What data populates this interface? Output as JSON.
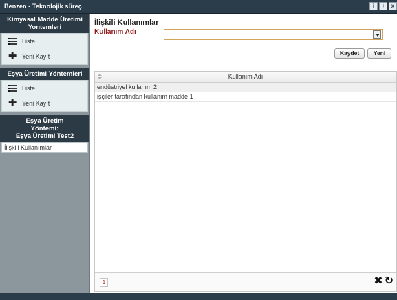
{
  "app": {
    "title": "Benzen - Teknolojik süreç"
  },
  "window_icons": [
    "i",
    "+",
    "x"
  ],
  "sidebar": {
    "sections": [
      {
        "header": "Kimyasal Madde Üretimi Yontemleri",
        "items": [
          {
            "label": "Liste",
            "icon": "list-icon"
          },
          {
            "label": "Yeni Kayıt",
            "icon": "plus-icon"
          }
        ]
      },
      {
        "header": "Eşya Üretimi Yöntemleri",
        "items": [
          {
            "label": "Liste",
            "icon": "list-icon"
          },
          {
            "label": "Yeni Kayıt",
            "icon": "plus-icon"
          }
        ]
      }
    ],
    "context_header_line1": "Eşya Üretim",
    "context_header_line2": "Yöntemi:",
    "context_header_line3": "Eşya Üretimi Test2",
    "selected_link": "İlişkili Kullanımlar"
  },
  "main": {
    "title": "İlişkili Kullanımlar",
    "field_label": "Kullanım Adı",
    "select_value": "",
    "save_label": "Kaydet",
    "new_label": "Yeni"
  },
  "grid": {
    "column": "Kullanım Adı",
    "rows": [
      "endüstriyel kullanım 2",
      "işçiler tarafından kullanım madde 1"
    ],
    "page": "1"
  },
  "colors": {
    "header_bg": "#2c3a45",
    "sidebar_bg": "#8c979d",
    "label_red": "#8f1a1a",
    "select_border": "#d0a55a"
  }
}
